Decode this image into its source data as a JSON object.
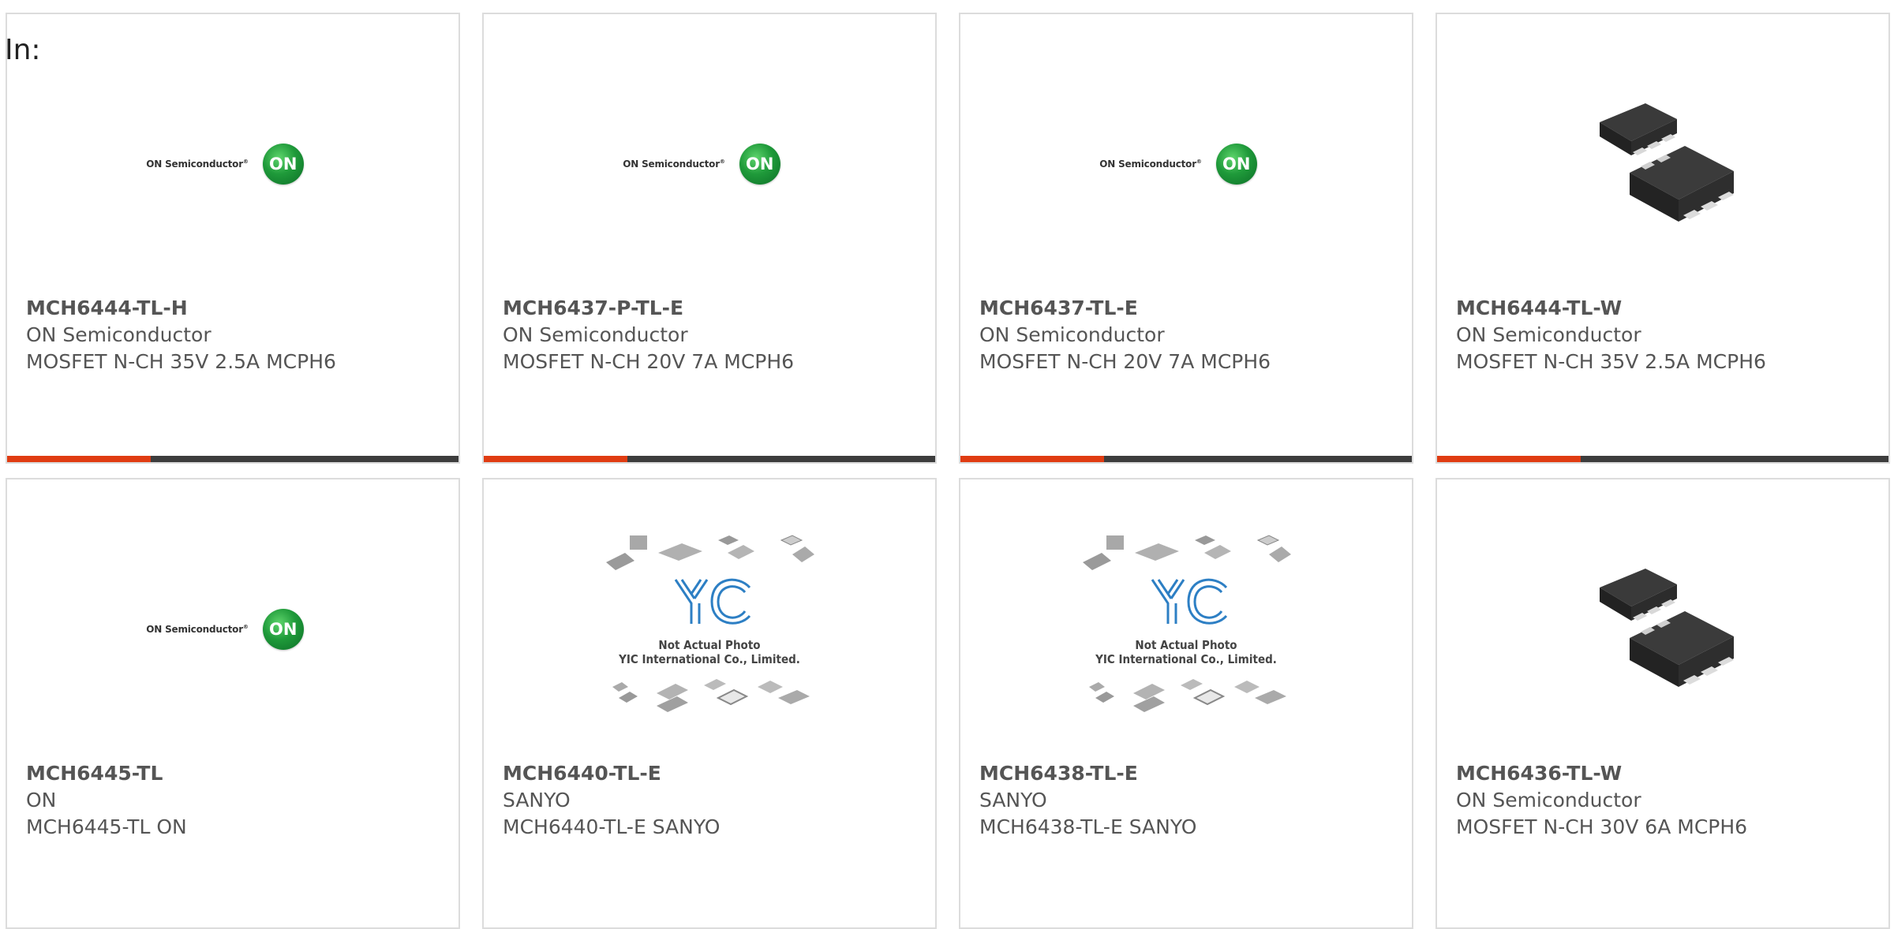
{
  "header": {
    "in_label": "In:"
  },
  "logo": {
    "on_text": "ON Semiconductor",
    "on_badge": "ON"
  },
  "placeholder": {
    "line1": "Not Actual Photo",
    "line2": "YIC International Co., Limited."
  },
  "colors": {
    "accent": "#e03c12",
    "bar": "#3d3d3d",
    "text": "#555555",
    "border": "#dcdcdc"
  },
  "products": [
    {
      "part": "MCH6444-TL-H",
      "mfr": "ON Semiconductor",
      "desc": "MOSFET N-CH 35V 2.5A MCPH6",
      "image": "on-semi-logo"
    },
    {
      "part": "MCH6437-P-TL-E",
      "mfr": "ON Semiconductor",
      "desc": "MOSFET N-CH 20V 7A MCPH6",
      "image": "on-semi-logo"
    },
    {
      "part": "MCH6437-TL-E",
      "mfr": "ON Semiconductor",
      "desc": "MOSFET N-CH 20V 7A MCPH6",
      "image": "on-semi-logo"
    },
    {
      "part": "MCH6444-TL-W",
      "mfr": "ON Semiconductor",
      "desc": "MOSFET N-CH 35V 2.5A MCPH6",
      "image": "chip-photo"
    },
    {
      "part": "MCH6445-TL",
      "mfr": "ON",
      "desc": "MCH6445-TL ON",
      "image": "on-semi-logo"
    },
    {
      "part": "MCH6440-TL-E",
      "mfr": "SANYO",
      "desc": "MCH6440-TL-E SANYO",
      "image": "yic-placeholder"
    },
    {
      "part": "MCH6438-TL-E",
      "mfr": "SANYO",
      "desc": "MCH6438-TL-E SANYO",
      "image": "yic-placeholder"
    },
    {
      "part": "MCH6436-TL-W",
      "mfr": "ON Semiconductor",
      "desc": "MOSFET N-CH 30V 6A MCPH6",
      "image": "chip-photo"
    }
  ]
}
